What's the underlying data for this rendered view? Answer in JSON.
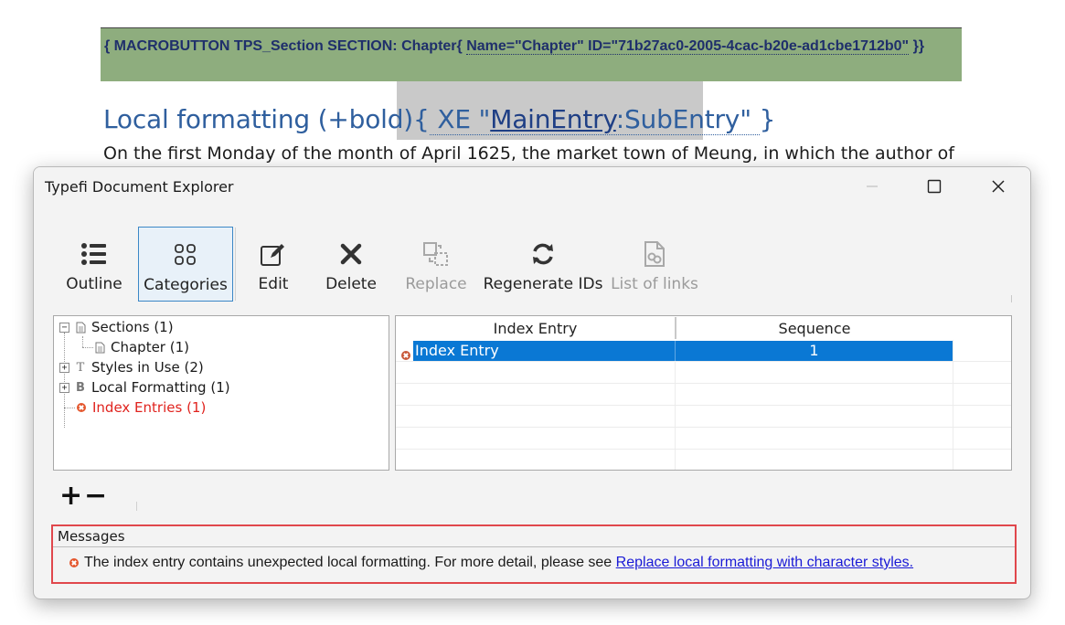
{
  "document": {
    "macro_prefix": "{ MACROBUTTON TPS_Section SECTION: Chapter{ ",
    "macro_field": "Name=\"Chapter\" ID=\"71b27ac0-2005-4cac-b20e-ad1cbe1712b0\"",
    "macro_suffix": " }}",
    "heading_text": "Local formatting (+bold)",
    "heading_field_open": "{",
    "heading_xe_prefix": " XE \"",
    "heading_main_entry": "MainEntry",
    "heading_sub_entry": ":SubEntry",
    "heading_xe_suffix": "\" ",
    "heading_field_close": "}",
    "paragraph": "On the first Monday of the month of April 1625, the market town of Meung, in which the author of"
  },
  "dialog": {
    "title": "Typefi Document Explorer",
    "toolbar": {
      "outline": "Outline",
      "categories": "Categories",
      "edit": "Edit",
      "delete": "Delete",
      "replace": "Replace",
      "regenerate": "Regenerate IDs",
      "links": "List of links"
    },
    "tree": {
      "sections": "Sections (1)",
      "chapter": "Chapter (1)",
      "styles": "Styles in Use (2)",
      "local_formatting": "Local Formatting (1)",
      "index_entries": "Index Entries (1)"
    },
    "grid": {
      "headers": [
        "Index Entry",
        "Sequence"
      ],
      "rows": [
        {
          "entry": "Index Entry",
          "sequence": "1"
        }
      ]
    },
    "plus": "+",
    "minus": "−",
    "messages": {
      "title": "Messages",
      "text": "The index entry contains unexpected local formatting. For more detail, please see ",
      "link": "Replace local formatting with character styles."
    }
  },
  "colors": {
    "selection": "#0a78d4",
    "error": "#e0231e",
    "messages_border": "#e0474c",
    "macro_bar": "#8ead7e",
    "heading": "#2f5f9e"
  },
  "icons": {
    "outline": "list-icon",
    "categories": "grid-icon",
    "edit": "edit-icon",
    "delete": "close-x-icon",
    "replace": "replace-icon",
    "regenerate": "refresh-icon",
    "links": "document-link-icon"
  }
}
